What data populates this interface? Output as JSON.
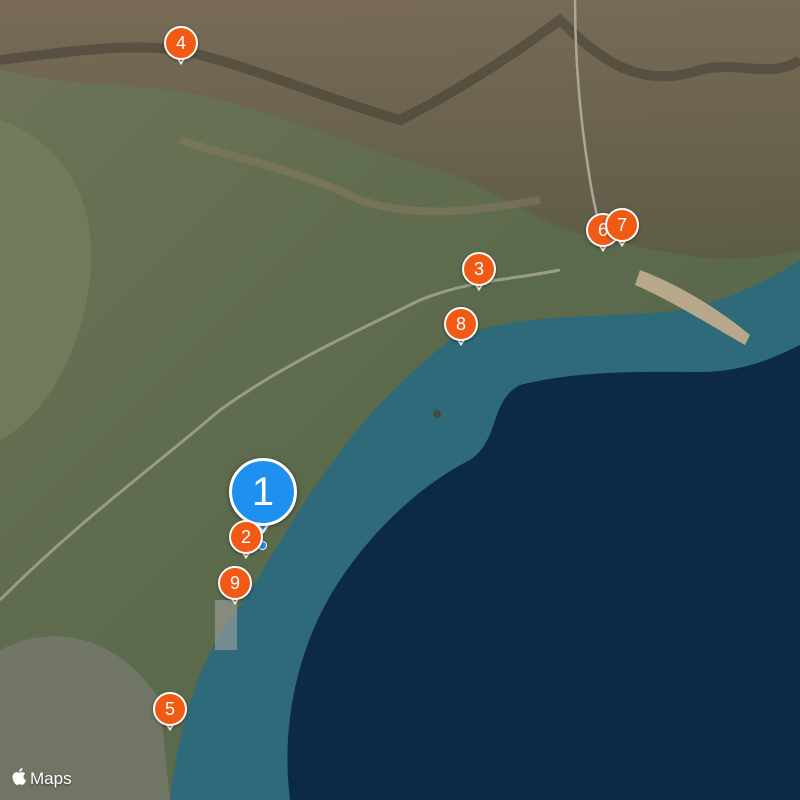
{
  "map": {
    "type": "satellite",
    "colors": {
      "sea": "#0d2a44",
      "shallow_sea": "#2f6a7a",
      "land": "#5f6a4e",
      "mountain": "#6a5a48",
      "pin": "#f05a14",
      "selected_pin": "#1e90f0"
    }
  },
  "markers": [
    {
      "label": "1",
      "selected": true
    },
    {
      "label": "2"
    },
    {
      "label": "3"
    },
    {
      "label": "4"
    },
    {
      "label": "5"
    },
    {
      "label": "6"
    },
    {
      "label": "7"
    },
    {
      "label": "8"
    },
    {
      "label": "9"
    }
  ],
  "attribution": {
    "icon": "apple-logo-icon",
    "text": "Maps"
  }
}
